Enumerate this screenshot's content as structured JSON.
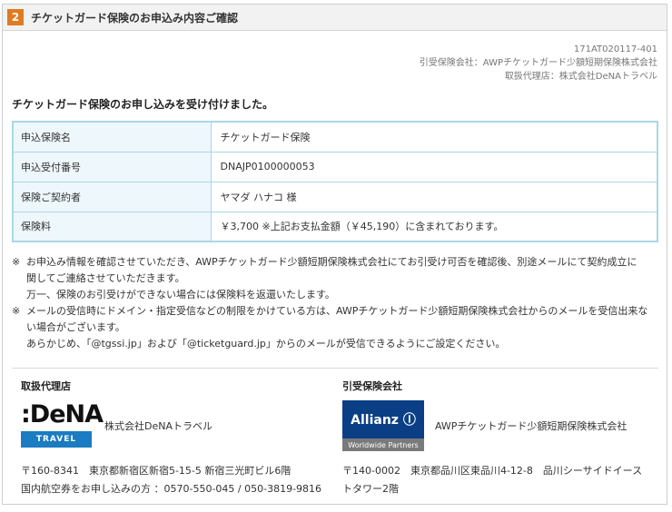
{
  "header": {
    "step": "2",
    "title": "チケットガード保険のお申込み内容ご確認"
  },
  "meta": {
    "code": "171AT020117-401",
    "insurer_line": "引受保険会社：AWPチケットガード少額短期保険株式会社",
    "agent_line": "取扱代理店：株式会社DeNAトラベル"
  },
  "confirm_message": "チケットガード保険のお申し込みを受け付けました。",
  "info_rows": [
    {
      "label": "申込保険名",
      "value": "チケットガード保険"
    },
    {
      "label": "申込受付番号",
      "value": "DNAJP0100000053"
    },
    {
      "label": "保険ご契約者",
      "value": "ヤマダ ハナコ 様"
    },
    {
      "label": "保険料",
      "value": "￥3,700 ※上記お支払金額（￥45,190）に含まれております。"
    }
  ],
  "notes": {
    "mark": "※",
    "note1_line1": "お申込み情報を確認させていただき、AWPチケットガード少額短期保険株式会社にてお引受け可否を確認後、別途メールにて契約成立に",
    "note1_line2": "関してご連絡させていただきます。",
    "note1_line3": "万一、保険のお引受けができない場合には保険料を返還いたします。",
    "note2_line1": "メールの受信時にドメイン・指定受信などの制限をかけている方は、AWPチケットガード少額短期保険株式会社からのメールを受信出来な",
    "note2_line2": "い場合がございます。",
    "note2_line3": "あらかじめ、「@tgssi.jp」および「@ticketguard.jp」からのメールが受信できるようにご設定ください。"
  },
  "agent": {
    "heading": "取扱代理店",
    "logo_text": ":DeNA",
    "logo_sub": "TRAVEL",
    "company": "株式会社DeNAトラベル",
    "address": "〒160-8341　東京都新宿区新宿5-15-5 新宿三光町ビル6階",
    "contact": "国内航空券をお申し込みの方 ：0570-550-045 / 050-3819-9816"
  },
  "insurer": {
    "heading": "引受保険会社",
    "logo_text": "Allianz Ⓘ",
    "logo_sub": "Worldwide Partners",
    "company": "AWPチケットガード少額短期保険株式会社",
    "address_line1": "〒140-0002　東京都品川区東品川4-12-8　品川シーサイドイース",
    "address_line2": "トタワー2階"
  }
}
